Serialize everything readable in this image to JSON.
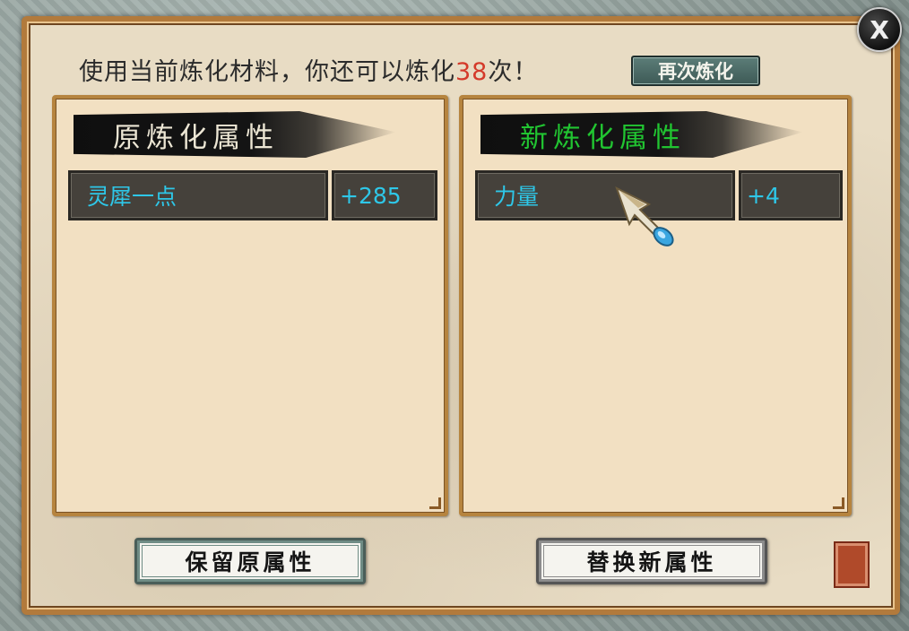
{
  "dialog": {
    "close_label": "X",
    "header_prefix": "使用当前炼化材料，你还可以炼化",
    "remaining_count": "38",
    "header_suffix": "次！",
    "refine_again_label": "再次炼化"
  },
  "original_panel": {
    "title": "原炼化属性",
    "attribute": {
      "name": "灵犀一点",
      "value": "+285"
    }
  },
  "new_panel": {
    "title": "新炼化属性",
    "attribute": {
      "name": "力量",
      "value": "+4"
    }
  },
  "actions": {
    "keep_label": "保留原属性",
    "replace_label": "替换新属性"
  },
  "colors": {
    "remaining_count": "#d43a2a",
    "new_title": "#21c431",
    "attribute_text": "#2ec7e8",
    "panel_border": "#b6843f"
  },
  "icons": {
    "close": "close-icon",
    "cursor": "arrow-cursor-icon",
    "seal": "seal-stamp-icon"
  }
}
